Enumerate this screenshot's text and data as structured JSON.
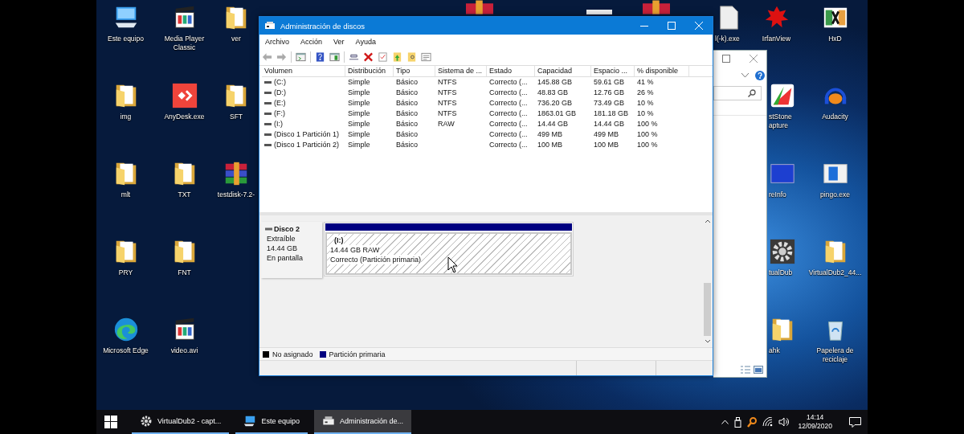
{
  "desktop": {
    "left_columns": [
      [
        {
          "label": "Este equipo",
          "kind": "computer"
        },
        {
          "label": "img",
          "kind": "folder"
        },
        {
          "label": "mlt",
          "kind": "folder"
        },
        {
          "label": "PRY",
          "kind": "folder"
        },
        {
          "label": "Microsoft Edge",
          "kind": "edge"
        }
      ],
      [
        {
          "label": "Media Player Classic",
          "kind": "film"
        },
        {
          "label": "AnyDesk.exe",
          "kind": "anydesk"
        },
        {
          "label": "TXT",
          "kind": "folder"
        },
        {
          "label": "FNT",
          "kind": "folder"
        },
        {
          "label": "video.avi",
          "kind": "film"
        }
      ],
      [
        {
          "label": "ver",
          "kind": "folder"
        },
        {
          "label": "SFT",
          "kind": "folder"
        },
        {
          "label": "testdisk-7.2-",
          "kind": "archive"
        }
      ]
    ],
    "right_columns": [
      [
        {
          "label": "l(-k).exe",
          "kind": "app",
          "partial": true
        }
      ],
      [
        {
          "label": "IrfanView",
          "kind": "irfan",
          "partial": false
        },
        {
          "label": "stStone apture",
          "kind": "capture",
          "partial": true
        },
        {
          "label": "reInfo",
          "kind": "exe",
          "partial": true
        },
        {
          "label": "tualDub",
          "kind": "gear",
          "partial": true
        },
        {
          "label": "ahk",
          "kind": "folder",
          "partial": true
        }
      ],
      [
        {
          "label": "HxD",
          "kind": "hxd",
          "partial": false
        },
        {
          "label": "Audacity",
          "kind": "audacity",
          "partial": false
        },
        {
          "label": "pingo.exe",
          "kind": "pingo",
          "partial": false
        },
        {
          "label": "VirtualDub2_44...",
          "kind": "folder",
          "partial": false
        },
        {
          "label": "Papelera de reciclaje",
          "kind": "recycle",
          "partial": false
        }
      ]
    ]
  },
  "disk_window": {
    "title": "Administración de discos",
    "menu": [
      "Archivo",
      "Acción",
      "Ver",
      "Ayuda"
    ],
    "columns": [
      "Volumen",
      "Distribución",
      "Tipo",
      "Sistema de ...",
      "Estado",
      "Capacidad",
      "Espacio ...",
      "% disponible"
    ],
    "rows": [
      {
        "volume": "(C:)",
        "layout": "Simple",
        "type": "Básico",
        "fs": "NTFS",
        "status": "Correcto (...",
        "capacity": "145.88 GB",
        "free": "59.61 GB",
        "pct": "41 %"
      },
      {
        "volume": "(D:)",
        "layout": "Simple",
        "type": "Básico",
        "fs": "NTFS",
        "status": "Correcto (...",
        "capacity": "48.83 GB",
        "free": "12.76 GB",
        "pct": "26 %"
      },
      {
        "volume": "(E:)",
        "layout": "Simple",
        "type": "Básico",
        "fs": "NTFS",
        "status": "Correcto (...",
        "capacity": "736.20 GB",
        "free": "73.49 GB",
        "pct": "10 %"
      },
      {
        "volume": "(F:)",
        "layout": "Simple",
        "type": "Básico",
        "fs": "NTFS",
        "status": "Correcto (...",
        "capacity": "1863.01 GB",
        "free": "181.18 GB",
        "pct": "10 %"
      },
      {
        "volume": "(I:)",
        "layout": "Simple",
        "type": "Básico",
        "fs": "RAW",
        "status": "Correcto (...",
        "capacity": "14.44 GB",
        "free": "14.44 GB",
        "pct": "100 %"
      },
      {
        "volume": "(Disco 1 Partición 1)",
        "layout": "Simple",
        "type": "Básico",
        "status": "Correcto (...",
        "capacity": "499 MB",
        "free": "499 MB",
        "pct": "100 %"
      },
      {
        "volume": "(Disco 1 Partición 2)",
        "layout": "Simple",
        "type": "Básico",
        "status": "Correcto (...",
        "capacity": "100 MB",
        "free": "100 MB",
        "pct": "100 %"
      }
    ],
    "disk": {
      "name": "Disco 2",
      "type": "Extraíble",
      "size": "14.44 GB",
      "status": "En pantalla"
    },
    "partition": {
      "label": "(I:)",
      "size": "14.44 GB RAW",
      "status": "Correcto (Partición primaria)",
      "selected": true
    },
    "legend": [
      {
        "label": "No asignado",
        "color": "#000000"
      },
      {
        "label": "Partición primaria",
        "color": "#000080"
      }
    ]
  },
  "taskbar": {
    "items": [
      {
        "label": "VirtualDub2 - capt...",
        "kind": "gear",
        "selected": false
      },
      {
        "label": "Este equipo",
        "kind": "computer",
        "selected": false
      },
      {
        "label": "Administración de...",
        "kind": "disk",
        "selected": true
      }
    ],
    "time": "14:14",
    "date": "12/09/2020"
  }
}
